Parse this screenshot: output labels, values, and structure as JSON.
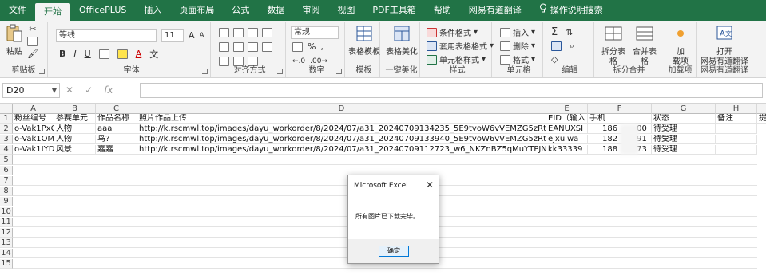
{
  "tabs": [
    "文件",
    "开始",
    "OfficePLUS",
    "插入",
    "页面布局",
    "公式",
    "数据",
    "审阅",
    "视图",
    "PDF工具箱",
    "帮助",
    "网易有道翻译",
    "操作说明搜索"
  ],
  "active_tab": "开始",
  "colors": {
    "accent": "#217346",
    "ribbon_bg": "#f3f3f3",
    "header_bg": "#f3f3f3"
  },
  "ribbon": {
    "clipboard": {
      "paste": "粘贴",
      "label": "剪贴板"
    },
    "font": {
      "name": "等线",
      "size": "11",
      "bold": "B",
      "italic": "I",
      "underline": "U",
      "grow": "A",
      "shrink": "A",
      "label": "字体"
    },
    "alignment": {
      "label": "对齐方式"
    },
    "number": {
      "format": "常规",
      "label": "数字"
    },
    "template": {
      "btn": "表格模板",
      "label": "模板"
    },
    "beautify": {
      "btn": "表格美化",
      "label": "一键美化"
    },
    "styles": {
      "conditional": "条件格式",
      "table_format": "套用表格格式",
      "cell_styles": "单元格样式",
      "label": "样式"
    },
    "cells": {
      "insert": "插入",
      "delete": "删除",
      "format": "格式",
      "label": "单元格"
    },
    "editing": {
      "label": "编辑"
    },
    "split": {
      "split_table": "拆分表格",
      "merge_table": "合并表格",
      "label": "拆分合并"
    },
    "addin": {
      "btn1": "加",
      "btn2": "载项",
      "label": "加载项"
    },
    "youdao": {
      "btn1": "打开",
      "btn2": "网易有道翻译",
      "label": "网易有道翻译"
    }
  },
  "formula_bar": {
    "namebox": "D20",
    "cancel": "✕",
    "enter": "✓",
    "fx": "fx",
    "value": ""
  },
  "columns": [
    "A",
    "B",
    "C",
    "D",
    "E",
    "F",
    "G",
    "H"
  ],
  "rows": [
    "1",
    "2",
    "3",
    "4",
    "5",
    "6",
    "7",
    "8",
    "9",
    "10",
    "11",
    "12",
    "13",
    "14",
    "15"
  ],
  "table": {
    "headers": [
      "粉丝编号",
      "参赛单元",
      "作品名称",
      "照片作品上传",
      "EID（输入",
      "手机",
      "状态",
      "备注",
      "提"
    ],
    "rows": [
      [
        "o-Vak1PxC",
        "人物",
        "aaa",
        "http://k.rscmwl.top/images/dayu_workorder/8/2024/07/a31_20240709134235_5E9tvoW6vVEMZG5zRthWY3v",
        "EANUXSI",
        "186",
        "00",
        "待受理"
      ],
      [
        "o-Vak1OM",
        "人物",
        "鸟?",
        "http://k.rscmwl.top/images/dayu_workorder/8/2024/07/a31_20240709133940_5E9tvoW6vVEMZG5zRthWYwt",
        "ejxuiwa",
        "182",
        "91",
        "待受理"
      ],
      [
        "o-Vak1IYD",
        "风景",
        "嘉嘉",
        "http://k.rscmwl.top/images/dayu_workorder/8/2024/07/a31_20240709112723_w6_NKZnBZ5qMuYTPJNkBwzC",
        "kk33339",
        "188",
        "73",
        "待受理"
      ]
    ]
  },
  "dialog": {
    "title": "Microsoft Excel",
    "close": "✕",
    "message": "所有图片已下载完毕。",
    "ok": "确定"
  }
}
